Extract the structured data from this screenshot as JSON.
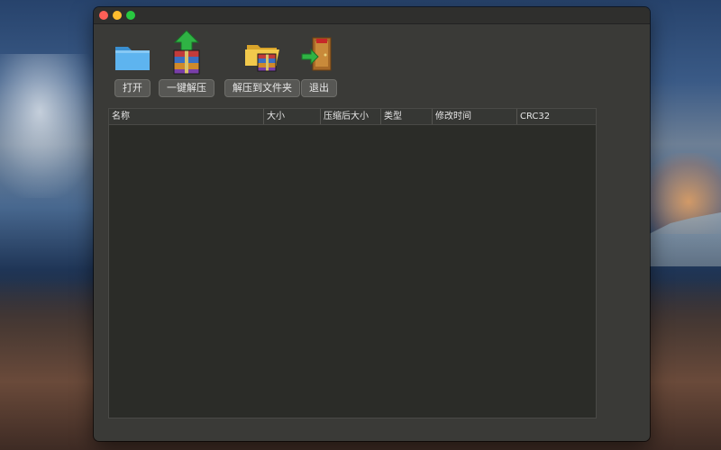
{
  "toolbar": {
    "open_label": "打开",
    "extract_label": "一键解压",
    "extract_to_folder_label": "解压到文件夹",
    "exit_label": "退出",
    "icons": [
      "folder-icon",
      "archive-extract-icon",
      "folder-archive-icon",
      "exit-door-icon"
    ]
  },
  "table": {
    "columns": [
      "名称",
      "大小",
      "压缩后大小",
      "类型",
      "修改时间",
      "CRC32"
    ],
    "rows": []
  },
  "colors": {
    "window_bg": "#3a3a37",
    "list_bg": "#2b2c28",
    "close": "#fe5f57",
    "minimize": "#febc2e",
    "maximize": "#28c840"
  }
}
